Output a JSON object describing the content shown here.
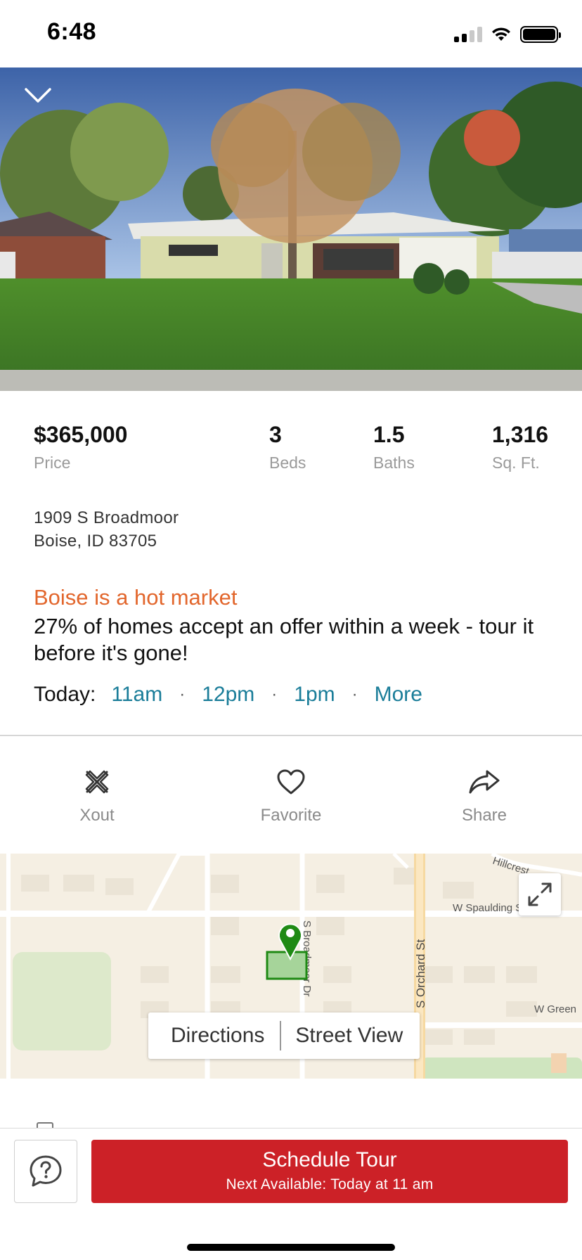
{
  "status_bar": {
    "time": "6:48"
  },
  "listing": {
    "price": "$365,000",
    "price_label": "Price",
    "beds": "3",
    "beds_label": "Beds",
    "baths": "1.5",
    "baths_label": "Baths",
    "sqft": "1,316",
    "sqft_label": "Sq. Ft.",
    "address_line1": "1909 S Broadmoor",
    "address_line2": "Boise, ID 83705"
  },
  "market": {
    "title": "Boise is a hot market",
    "body": "27% of homes accept an offer within a week - tour it before it's gone!"
  },
  "tour_times": {
    "today_label": "Today:",
    "slots": [
      "11am",
      "12pm",
      "1pm"
    ],
    "more_label": "More",
    "separator": "·"
  },
  "actions": {
    "xout_label": "Xout",
    "favorite_label": "Favorite",
    "share_label": "Share"
  },
  "map": {
    "directions_label": "Directions",
    "street_view_label": "Street View",
    "streets": {
      "hillcrest": "Hillcrest",
      "spaulding": "W Spaulding St",
      "orchard": "S Orchard St",
      "broadmoor": "S Broadmoor Dr",
      "green": "W Green"
    },
    "colors": {
      "pin": "#1f8a14",
      "parcel_fill": "#a6d49a",
      "land": "#f5efe3",
      "park": "#dde9cb"
    }
  },
  "bottom_bar": {
    "schedule_title": "Schedule Tour",
    "schedule_subtitle": "Next Available: Today at 11 am",
    "help_icon": "question-bubble-icon",
    "accent_color": "#cc2127"
  }
}
